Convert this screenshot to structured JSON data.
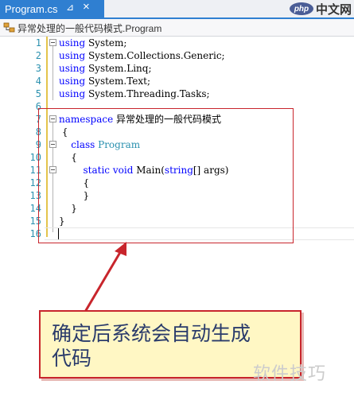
{
  "tab": {
    "title": "Program.cs",
    "pin_glyph": "⊿",
    "close_glyph": "×"
  },
  "navbar": {
    "path": "异常处理的一般代码模式.Program"
  },
  "code_lines": [
    {
      "n": "1",
      "text": "using System;"
    },
    {
      "n": "2",
      "text": "using System.Collections.Generic;"
    },
    {
      "n": "3",
      "text": "using System.Linq;"
    },
    {
      "n": "4",
      "text": "using System.Text;"
    },
    {
      "n": "5",
      "text": "using System.Threading.Tasks;"
    },
    {
      "n": "6",
      "text": ""
    },
    {
      "n": "7",
      "text": "namespace 异常处理的一般代码模式"
    },
    {
      "n": "8",
      "text": "{"
    },
    {
      "n": "9",
      "text": "class Program"
    },
    {
      "n": "10",
      "text": "{"
    },
    {
      "n": "11",
      "text": "static void Main(string[] args)"
    },
    {
      "n": "12",
      "text": "{"
    },
    {
      "n": "13",
      "text": "}"
    },
    {
      "n": "14",
      "text": "}"
    },
    {
      "n": "15",
      "text": "}"
    },
    {
      "n": "16",
      "text": ""
    }
  ],
  "callout": {
    "line1": "确定后系统会自动生成",
    "line2": "代码"
  },
  "logo": {
    "mark": "php",
    "name": "中文网"
  },
  "watermark": "软件技巧",
  "colors": {
    "tab": "#2f7fd1",
    "keyword": "#0000ff",
    "type": "#2b91af",
    "highlight": "#c8252c",
    "callout_bg": "#fff7c4"
  }
}
